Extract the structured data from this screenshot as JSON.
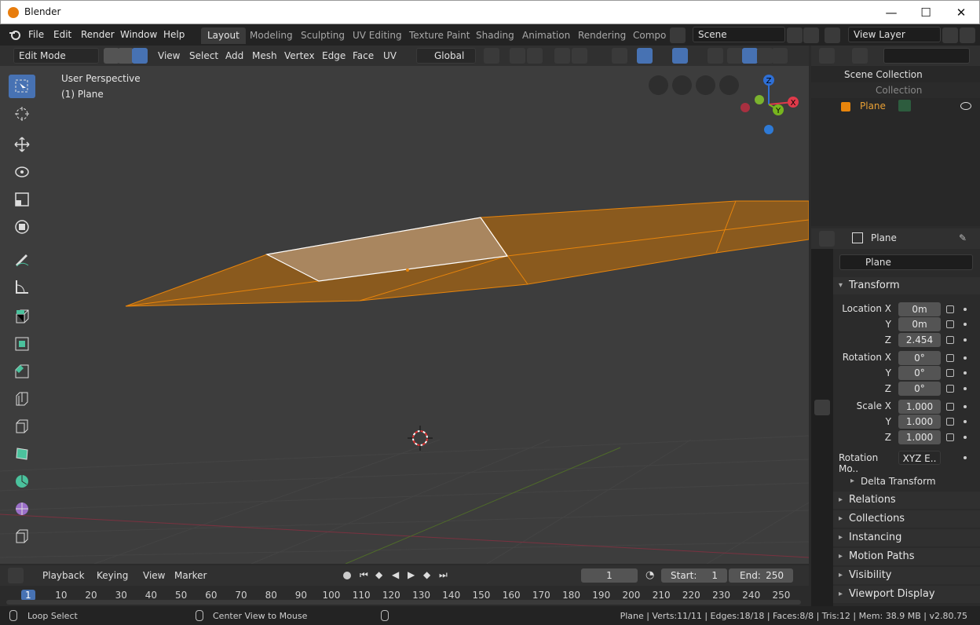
{
  "window": {
    "title": "Blender",
    "minimize": "—",
    "maximize": "☐",
    "close": "✕"
  },
  "menu": [
    "File",
    "Edit",
    "Render",
    "Window",
    "Help"
  ],
  "workspaces": [
    "Layout",
    "Modeling",
    "Sculpting",
    "UV Editing",
    "Texture Paint",
    "Shading",
    "Animation",
    "Rendering",
    "Compo"
  ],
  "scene": {
    "name": "Scene",
    "view_layer": "View Layer"
  },
  "viewport_header": {
    "mode": "Edit Mode",
    "menus": [
      "View",
      "Select",
      "Add",
      "Mesh",
      "Vertex",
      "Edge",
      "Face",
      "UV"
    ],
    "orientation": "Global"
  },
  "viewport": {
    "perspective": "User Perspective",
    "object": "(1) Plane"
  },
  "gizmo": {
    "z": "Z",
    "x": "X",
    "y": "Y"
  },
  "outliner": {
    "root": "Scene Collection",
    "collection": "Collection",
    "object": "Plane"
  },
  "properties": {
    "header_object": "Plane",
    "object_name": "Plane",
    "transform_title": "Transform",
    "location_label": "Location X",
    "rotation_label": "Rotation X",
    "scale_label": "Scale X",
    "y_label": "Y",
    "z_label": "Z",
    "location": [
      "0m",
      "0m",
      "2.454"
    ],
    "rotation": [
      "0°",
      "0°",
      "0°"
    ],
    "scale": [
      "1.000",
      "1.000",
      "1.000"
    ],
    "rotation_mode_label": "Rotation Mo..",
    "rotation_mode": "XYZ E..",
    "delta": "Delta Transform",
    "sections": [
      "Relations",
      "Collections",
      "Instancing",
      "Motion Paths",
      "Visibility",
      "Viewport Display"
    ]
  },
  "timeline": {
    "menus": [
      "Playback",
      "Keying",
      "View",
      "Marker"
    ],
    "current_frame": "1",
    "start_label": "Start:",
    "start": "1",
    "end_label": "End:",
    "end": "250",
    "ruler": [
      "1",
      "10",
      "20",
      "30",
      "40",
      "50",
      "60",
      "70",
      "80",
      "90",
      "100",
      "110",
      "120",
      "130",
      "140",
      "150",
      "160",
      "170",
      "180",
      "190",
      "200",
      "210",
      "220",
      "230",
      "240",
      "250"
    ]
  },
  "statusbar": {
    "left": "Loop Select",
    "middle": "Center View to Mouse",
    "right": "Plane | Verts:11/11 | Edges:18/18 | Faces:8/8 | Tris:12 | Mem: 38.9 MB | v2.80.75"
  },
  "colors": {
    "accent": "#4772b3",
    "selection_orange": "#e8850c",
    "face_fill": "#8a5a1e"
  }
}
